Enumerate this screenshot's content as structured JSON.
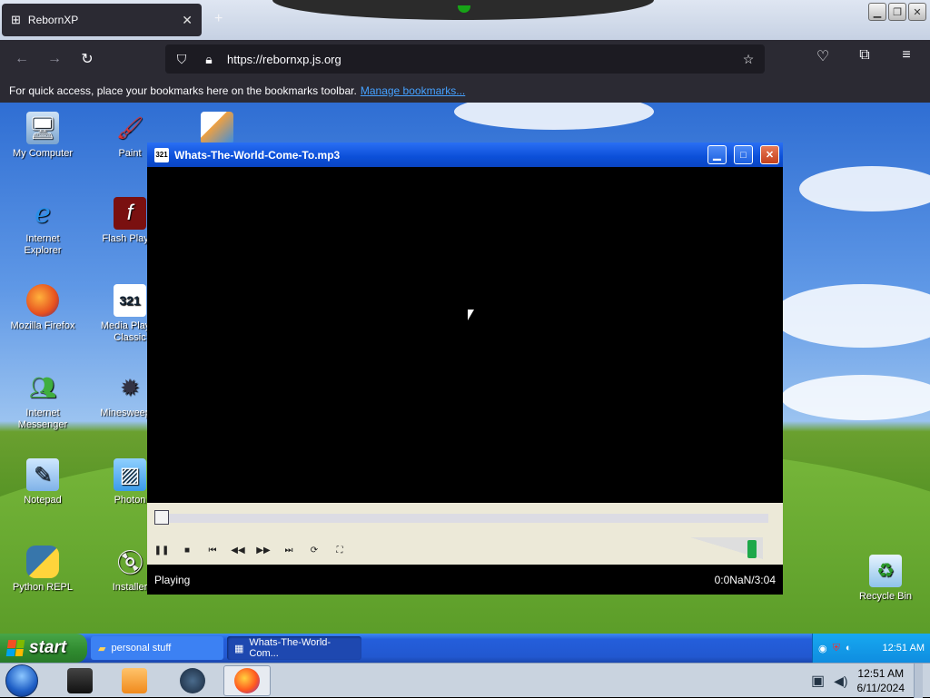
{
  "browser": {
    "tab_title": "RebornXP",
    "tab_close": "✕",
    "new_tab": "+",
    "url": "https://rebornxp.js.org",
    "bookmarks_hint": "For quick access, place your bookmarks here on the bookmarks toolbar.",
    "manage_bookmarks": "Manage bookmarks..."
  },
  "desktop": {
    "icons": [
      {
        "label": "My Computer"
      },
      {
        "label": "Internet Explorer"
      },
      {
        "label": "Mozilla Firefox"
      },
      {
        "label": "Internet Messenger"
      },
      {
        "label": "Notepad"
      },
      {
        "label": "Python REPL"
      },
      {
        "label": "Paint"
      },
      {
        "label": "Flash Player"
      },
      {
        "label": "Media Player Classic"
      },
      {
        "label": "Minesweeper"
      },
      {
        "label": "Photon"
      },
      {
        "label": "Installer"
      },
      {
        "label": "Recycle Bin"
      }
    ]
  },
  "media_player": {
    "title": "Whats-The-World-Come-To.mp3",
    "status": "Playing",
    "time": "0:0NaN/3:04",
    "volume_percent": 90,
    "seek_percent": 0
  },
  "xp_taskbar": {
    "start_label": "start",
    "tasks": [
      {
        "label": "personal stuff"
      },
      {
        "label": "Whats-The-World-Com..."
      }
    ],
    "clock": "12:51 AM"
  },
  "host_taskbar": {
    "time": "12:51 AM",
    "date": "6/11/2024"
  },
  "colors": {
    "xp_blue": "#245edb",
    "start_green": "#2f8a2f",
    "firefox_dark": "#2b2a33",
    "link": "#45a1ff"
  }
}
